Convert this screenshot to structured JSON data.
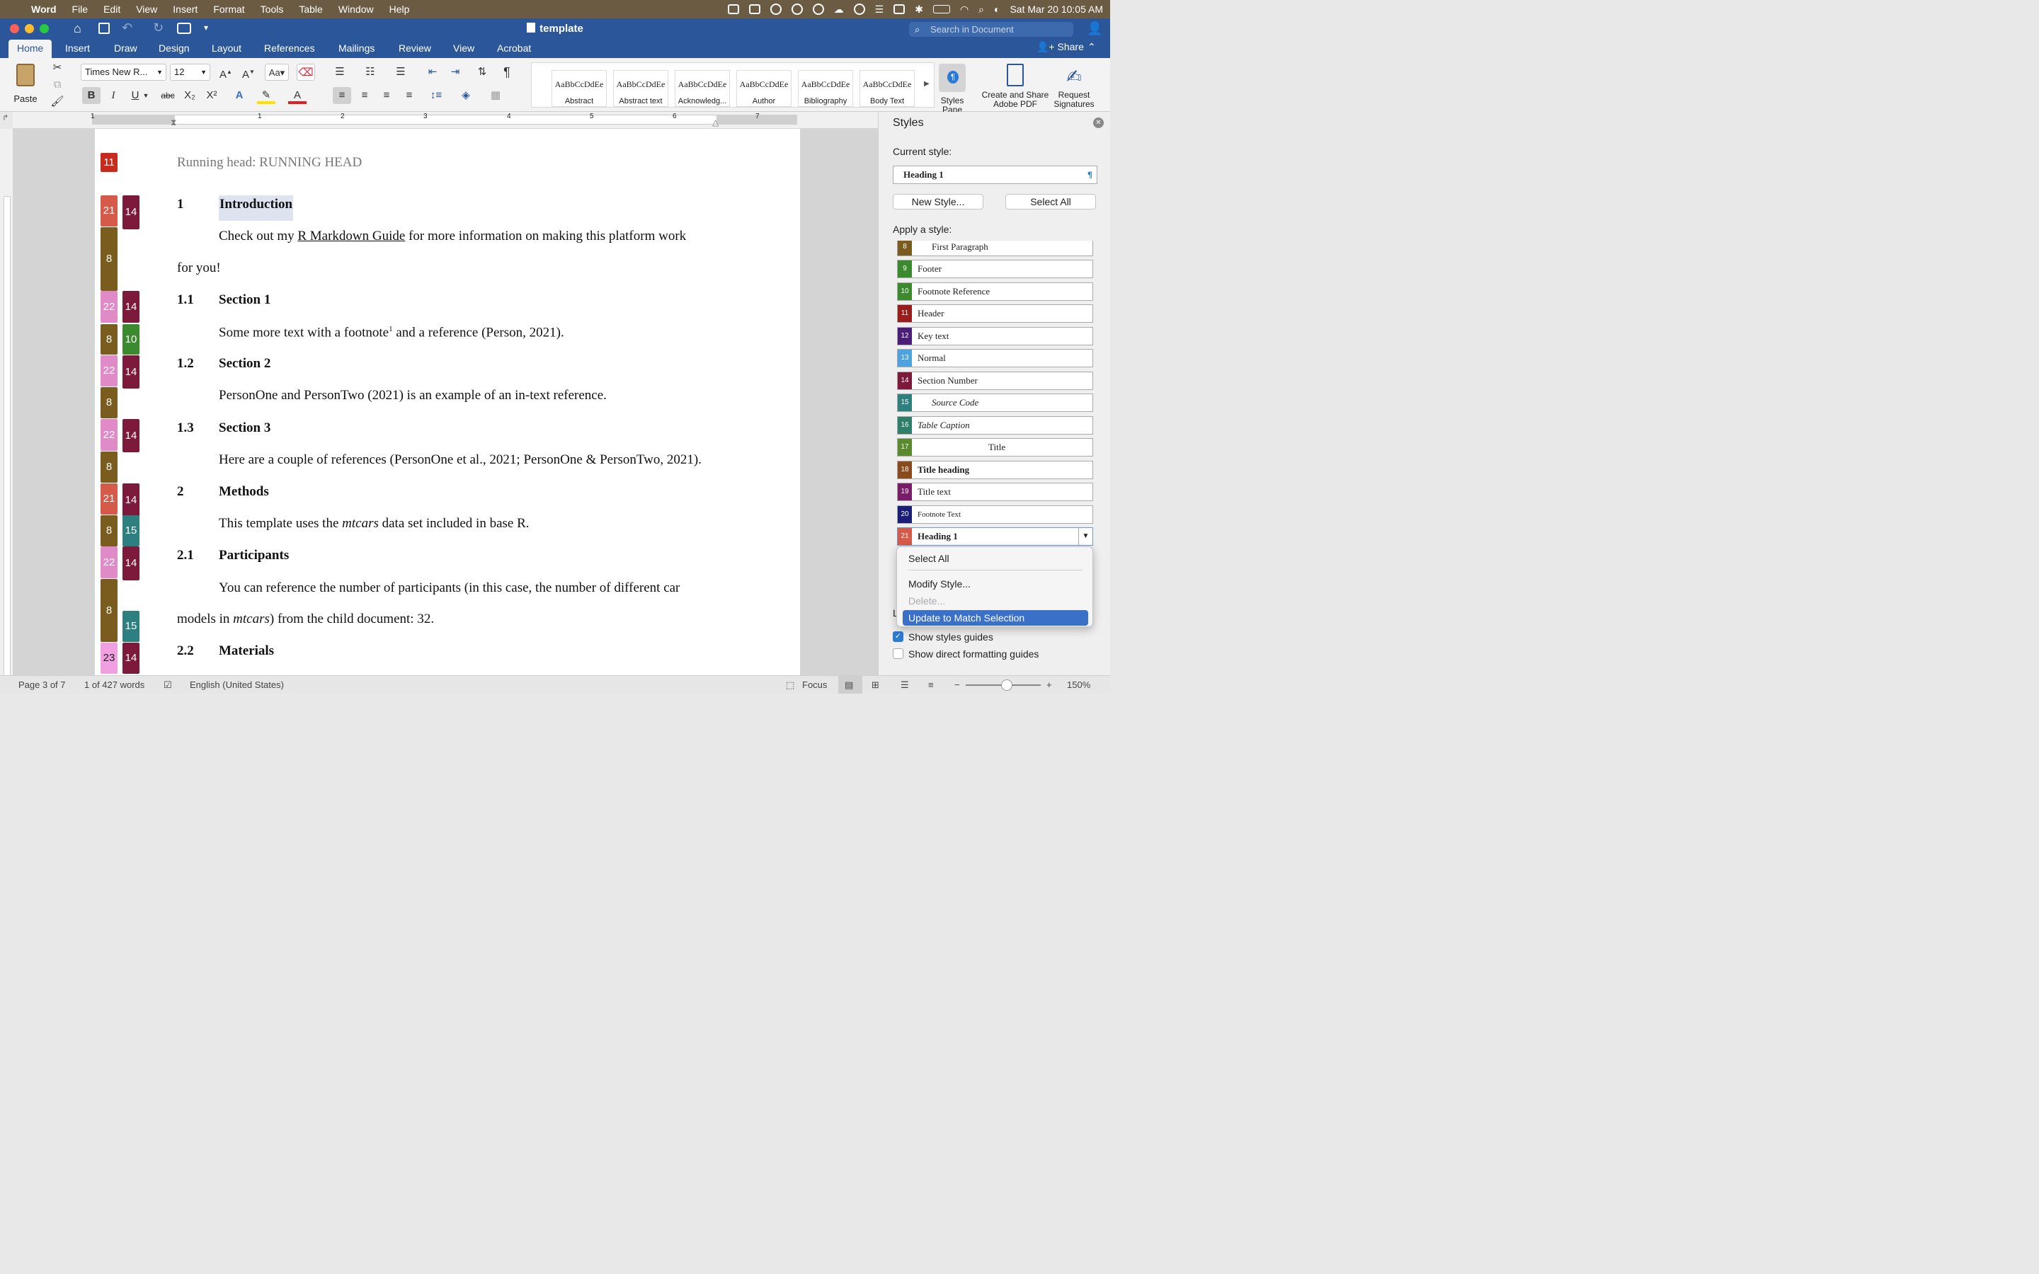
{
  "menubar": {
    "apple": "",
    "app": "Word",
    "items": [
      "File",
      "Edit",
      "View",
      "Insert",
      "Format",
      "Tools",
      "Table",
      "Window",
      "Help"
    ],
    "datetime": "Sat Mar 20  10:05 AM"
  },
  "window": {
    "title": "template",
    "search_placeholder": "Search in Document",
    "share": "Share"
  },
  "tabs": [
    "Home",
    "Insert",
    "Draw",
    "Design",
    "Layout",
    "References",
    "Mailings",
    "Review",
    "View",
    "Acrobat"
  ],
  "ribbon": {
    "paste": "Paste",
    "font_name": "Times New R...",
    "font_size": "12",
    "gallery": [
      {
        "preview": "AaBbCcDdEe",
        "label": "Abstract"
      },
      {
        "preview": "AaBbCcDdEe",
        "label": "Abstract text"
      },
      {
        "preview": "AaBbCcDdEe",
        "label": "Acknowledg..."
      },
      {
        "preview": "AaBbCcDdEe",
        "label": "Author"
      },
      {
        "preview": "AaBbCcDdEe",
        "label": "Bibliography"
      },
      {
        "preview": "AaBbCcDdEe",
        "label": "Body Text"
      }
    ],
    "styles_pane": "Styles Pane",
    "styles_pane_l1": "Styles",
    "styles_pane_l2": "Pane",
    "adobe_l1": "Create and Share",
    "adobe_l2": "Adobe PDF",
    "sign_l1": "Request",
    "sign_l2": "Signatures",
    "bold": "B",
    "italic": "I",
    "underline": "U",
    "strike": "abc",
    "sub": "X₂",
    "sup": "X²",
    "pilcrow": "¶"
  },
  "ruler": {
    "marks": [
      "1",
      "1",
      "2",
      "3",
      "4",
      "5",
      "6",
      "7"
    ]
  },
  "document": {
    "running_head": "Running head: RUNNING HEAD",
    "h1_num": "1",
    "h1": "Introduction",
    "p1a": "Check out my ",
    "p1link": "R Markdown Guide",
    "p1b": " for more information on making this platform work",
    "p1c": "for you!",
    "s11num": "1.1",
    "s11": "Section 1",
    "p2a": "Some more text with a footnote",
    "p2sup": "1",
    "p2b": " and a reference (Person, 2021).",
    "s12num": "1.2",
    "s12": "Section 2",
    "p3": "PersonOne and PersonTwo (2021) is an example of an in-text reference.",
    "s13num": "1.3",
    "s13": "Section 3",
    "p4": "Here are a couple of references (PersonOne et al., 2021; PersonOne & PersonTwo, 2021).",
    "h2num": "2",
    "h2": "Methods",
    "p5a": "This template uses the ",
    "p5i": "mtcars",
    "p5b": " data set included in base R.",
    "s21num": "2.1",
    "s21": "Participants",
    "p6": "You can reference the number of participants (in this case, the number of different car",
    "p7a": "models in ",
    "p7i": "mtcars",
    "p7b": ") from the child document: 32.",
    "s22num": "2.2",
    "s22": "Materials"
  },
  "guides": {
    "g11": "11",
    "g21": "21",
    "g14": "14",
    "g8": "8",
    "g22": "22",
    "g10": "10",
    "g15": "15",
    "g23": "23"
  },
  "pane": {
    "title": "Styles",
    "current_label": "Current style:",
    "current": "Heading 1",
    "new_style": "New Style...",
    "select_all": "Select All",
    "apply_label": "Apply a style:",
    "styles": [
      {
        "n": "8",
        "name": "First Paragraph"
      },
      {
        "n": "9",
        "name": "Footer"
      },
      {
        "n": "10",
        "name": "Footnote Reference"
      },
      {
        "n": "11",
        "name": "Header"
      },
      {
        "n": "12",
        "name": "Key text"
      },
      {
        "n": "13",
        "name": "Normal"
      },
      {
        "n": "14",
        "name": "Section Number"
      },
      {
        "n": "15",
        "name": "Source Code"
      },
      {
        "n": "16",
        "name": "Table Caption"
      },
      {
        "n": "17",
        "name": "Title"
      },
      {
        "n": "18",
        "name": "Title heading"
      },
      {
        "n": "19",
        "name": "Title text"
      },
      {
        "n": "20",
        "name": "Footnote Text"
      },
      {
        "n": "21",
        "name": "Heading 1"
      }
    ],
    "menu": [
      "Select All",
      "Modify Style...",
      "Delete...",
      "Update to Match Selection"
    ],
    "show_guides": "Show styles guides",
    "show_direct": "Show direct formatting guides",
    "list_partial": "L"
  },
  "status": {
    "page": "Page 3 of 7",
    "words": "1 of 427 words",
    "lang": "English (United States)",
    "focus": "Focus",
    "zoom": "150%"
  },
  "colors": {
    "word_blue": "#2b579a",
    "c8": "#7a5c1e",
    "c9": "#3c8a2e",
    "c10": "#3c8a2e",
    "c11": "#9a1c1c",
    "c12": "#4b1c7a",
    "c13": "#4da3e0",
    "c14": "#7d1a3c",
    "c15": "#2e7f80",
    "c16": "#2e7f6a",
    "c17": "#5a8a2e",
    "c18": "#8a4a1c",
    "c19": "#7a1c6a",
    "c20": "#1c1c7a",
    "c21": "#d65a4a",
    "c22": "#e08ac8",
    "c23": "#f0a0e0",
    "select": "#3b70c8"
  }
}
